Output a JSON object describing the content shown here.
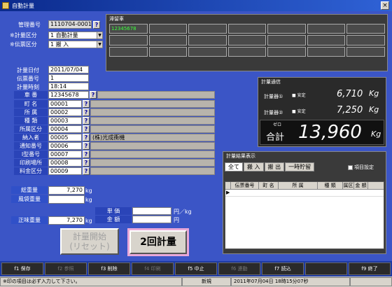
{
  "window": {
    "title": "自動計量"
  },
  "header": {
    "kanri_label": "管理番号",
    "kanri_value": "1110704-0001",
    "keiryo_kubun_label": "※計量区分",
    "keiryo_kubun_value": "1 自動計量",
    "denpyo_kubun_label": "※伝票区分",
    "denpyo_kubun_value": "1 搬 入"
  },
  "scale_panel": {
    "title": "滞留車",
    "cells": [
      "12345678",
      "",
      "",
      "",
      "",
      "",
      "",
      "",
      "",
      "",
      "",
      "",
      "",
      "",
      "",
      "",
      "",
      "",
      "",
      "",
      ""
    ]
  },
  "form": {
    "date_label": "計量日付",
    "date_value": "2011/07/04",
    "denpyo_label": "伝票番号",
    "denpyo_value": "1",
    "time_label": "計量時刻",
    "time_value": "18:14",
    "sharyo_label": "車 番",
    "sharyo_value": "12345678",
    "rows": [
      {
        "label": "町 名",
        "code": "00001",
        "name": ""
      },
      {
        "label": "所 属",
        "code": "00002",
        "name": ""
      },
      {
        "label": "種 類",
        "code": "00003",
        "name": ""
      },
      {
        "label": "所属区分",
        "code": "00004",
        "name": ""
      },
      {
        "label": "納入者",
        "code": "00005",
        "name": "(株)光成衝機"
      },
      {
        "label": "通知番号",
        "code": "00006",
        "name": ""
      },
      {
        "label": "I型番号",
        "code": "00007",
        "name": ""
      },
      {
        "label": "印刷場所",
        "code": "00008",
        "name": ""
      },
      {
        "label": "料金区分",
        "code": "00009",
        "name": ""
      }
    ]
  },
  "weights": {
    "total_label": "総重量",
    "total_value": "7,270",
    "unit": "kg",
    "tare_label": "風袋重量",
    "tare_value": "",
    "net_label": "正味重量",
    "net_value": "7,270",
    "price_label": "単 価",
    "price_unit": "円／kg",
    "amount_label": "金 額",
    "amount_unit": "円"
  },
  "buttons": {
    "start": "計量開始\n(リセット)",
    "second": "2回計量"
  },
  "comm_panel": {
    "title": "計量通信",
    "scale1_label": "計量器①",
    "scale1_status": "■ 安定",
    "scale1_value": "6,710",
    "kg": "Kg",
    "scale2_label": "計量器②",
    "scale2_status": "■ 安定",
    "scale2_value": "7,250",
    "zero_label": "ゼロ",
    "total_label": "合計",
    "total_value": "13,960"
  },
  "result_panel": {
    "title": "計量結果表示",
    "tabs": [
      "全て",
      "搬 入",
      "搬 出",
      "一時貯留"
    ],
    "checkbox_label": "項目設定",
    "columns": [
      "伝票番号",
      "町 名",
      "所 属",
      "種 類",
      "属区",
      "金 額"
    ]
  },
  "fkeys": [
    {
      "label": "f1  保存",
      "enabled": true
    },
    {
      "label": "f2  参照",
      "enabled": false
    },
    {
      "label": "f3  削除",
      "enabled": true
    },
    {
      "label": "f4  印刷",
      "enabled": false
    },
    {
      "label": "f5  中止",
      "enabled": true
    },
    {
      "label": "f6  連動",
      "enabled": false
    },
    {
      "label": "f7  読込",
      "enabled": true
    },
    {
      "label": "",
      "enabled": false
    },
    {
      "label": "f9  終了",
      "enabled": true
    }
  ],
  "status": {
    "message": "※印の項目は必ず入力して下さい。",
    "mode": "新規",
    "datetime": "2011年07月04日 18時15分07秒"
  }
}
